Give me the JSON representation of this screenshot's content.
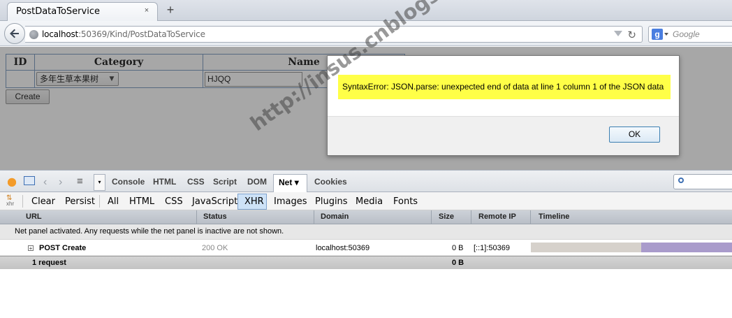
{
  "browser": {
    "tab_title": "PostDataToService",
    "tab_close": "×",
    "new_tab": "+",
    "url_host": "localhost",
    "url_path": ":50369/Kind/PostDataToService",
    "reload_glyph": "↻",
    "search_engine_letter": "g",
    "search_placeholder": "Google"
  },
  "page": {
    "table": {
      "headers": [
        "ID",
        "Category",
        "Name"
      ],
      "category_selected": "多年生草本果树",
      "name_value": "HJQQ"
    },
    "create_label": "Create"
  },
  "dialog": {
    "message": "SyntaxError: JSON.parse: unexpected end of data at line 1 column 1 of the JSON data",
    "ok_label": "OK"
  },
  "firebug": {
    "panel_tabs": [
      "Console",
      "HTML",
      "CSS",
      "Script",
      "DOM"
    ],
    "active_tab": "Net",
    "active_tab_caret": "▾",
    "extra_tab": "Cookies",
    "nav_back": "‹",
    "nav_fwd": "›",
    "menu_glyph": "≡",
    "menu_drop_glyph": "▾",
    "xhr_icon_label": "xhr",
    "actions": [
      "Clear",
      "Persist"
    ],
    "filters": [
      "All",
      "HTML",
      "CSS",
      "JavaScript",
      "XHR",
      "Images",
      "Plugins",
      "Media",
      "Fonts"
    ],
    "active_filter": "XHR",
    "columns": [
      "URL",
      "Status",
      "Domain",
      "Size",
      "Remote IP",
      "Timeline"
    ],
    "info": "Net panel activated. Any requests while the net panel is inactive are not shown.",
    "request": {
      "expand": "+",
      "url": "POST Create",
      "status": "200 OK",
      "domain": "localhost:50369",
      "size": "0 B",
      "remote_ip": "[::1]:50369"
    },
    "summary": {
      "count": "1 request",
      "size": "0 B"
    }
  },
  "watermark": "http://insus.cnblogs.com"
}
